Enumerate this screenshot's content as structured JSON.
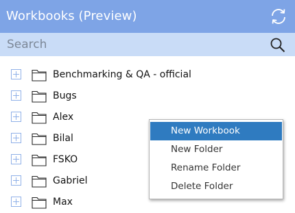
{
  "header": {
    "title": "Workbooks (Preview)",
    "refresh_icon": "refresh-icon"
  },
  "search": {
    "placeholder": "Search",
    "icon": "search-icon"
  },
  "tree": {
    "items": [
      {
        "label": "Benchmarking & QA - official"
      },
      {
        "label": "Bugs"
      },
      {
        "label": "Alex"
      },
      {
        "label": "Bilal"
      },
      {
        "label": "FSKO"
      },
      {
        "label": "Gabriel"
      },
      {
        "label": "Max"
      }
    ]
  },
  "context_menu": {
    "items": [
      {
        "label": "New Workbook",
        "selected": true
      },
      {
        "label": "New Folder"
      },
      {
        "label": "Rename Folder"
      },
      {
        "label": "Delete Folder"
      }
    ]
  },
  "colors": {
    "header_bg": "#7ea4e6",
    "search_bg": "#c9dcf7",
    "menu_selected": "#2f7bc0",
    "expand_icon": "#8fb0e8"
  }
}
